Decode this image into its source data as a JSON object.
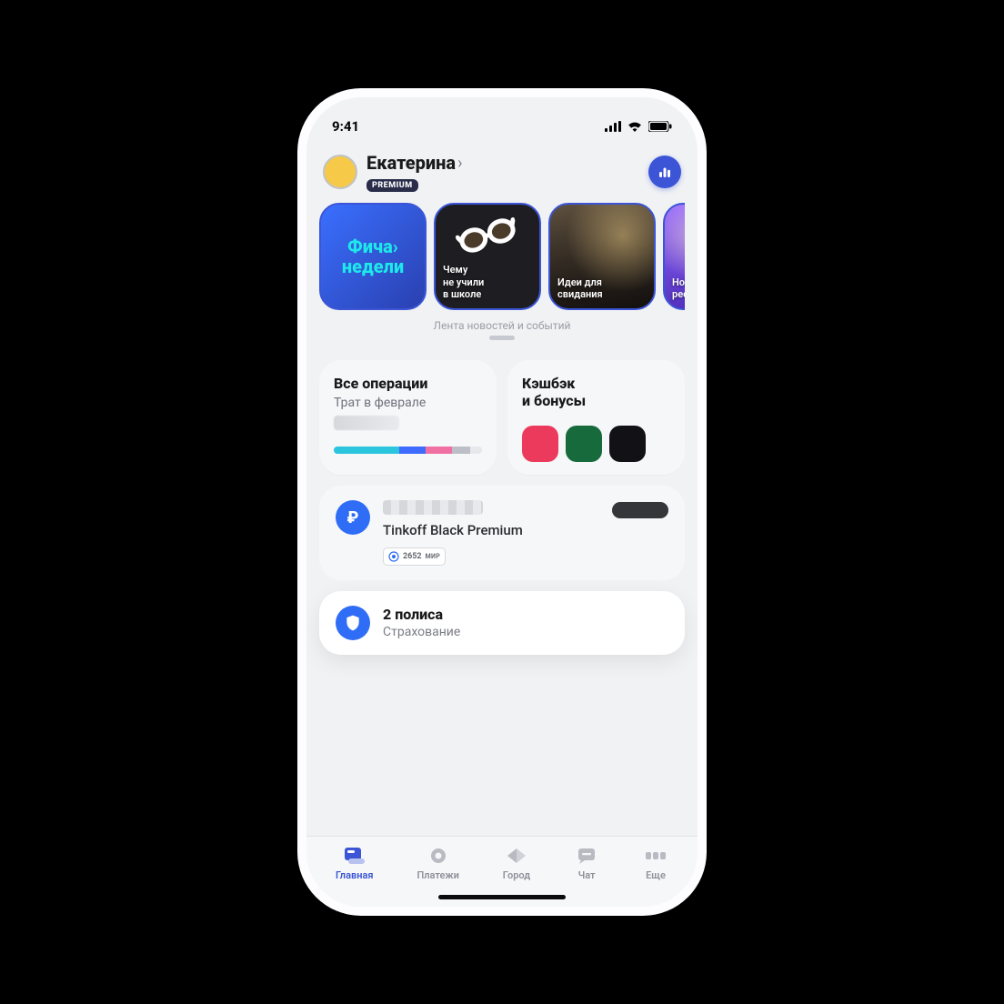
{
  "status": {
    "time": "9:41"
  },
  "user": {
    "name": "Екатерина",
    "tier_badge": "PREMIUM"
  },
  "stories": {
    "feed_label": "Лента новостей и событий",
    "items": [
      {
        "title_line1": "Фича",
        "title_line2": "недели"
      },
      {
        "title": "Чему\nне учили\nв школе"
      },
      {
        "title": "Идеи для\nсвидания"
      },
      {
        "title": "Новые\nрестора"
      }
    ]
  },
  "widgets": {
    "operations": {
      "title": "Все операции",
      "subtitle": "Трат в феврале"
    },
    "cashback": {
      "title": "Кэшбэк",
      "subtitle": "и бонусы"
    }
  },
  "account": {
    "name": "Tinkoff Black Premium",
    "card_last4": "2652",
    "card_scheme": "МИР"
  },
  "insurance": {
    "title": "2 полиса",
    "subtitle": "Страхование"
  },
  "tabs": [
    {
      "label": "Главная",
      "active": true
    },
    {
      "label": "Платежи",
      "active": false
    },
    {
      "label": "Город",
      "active": false
    },
    {
      "label": "Чат",
      "active": false
    },
    {
      "label": "Еще",
      "active": false
    }
  ]
}
